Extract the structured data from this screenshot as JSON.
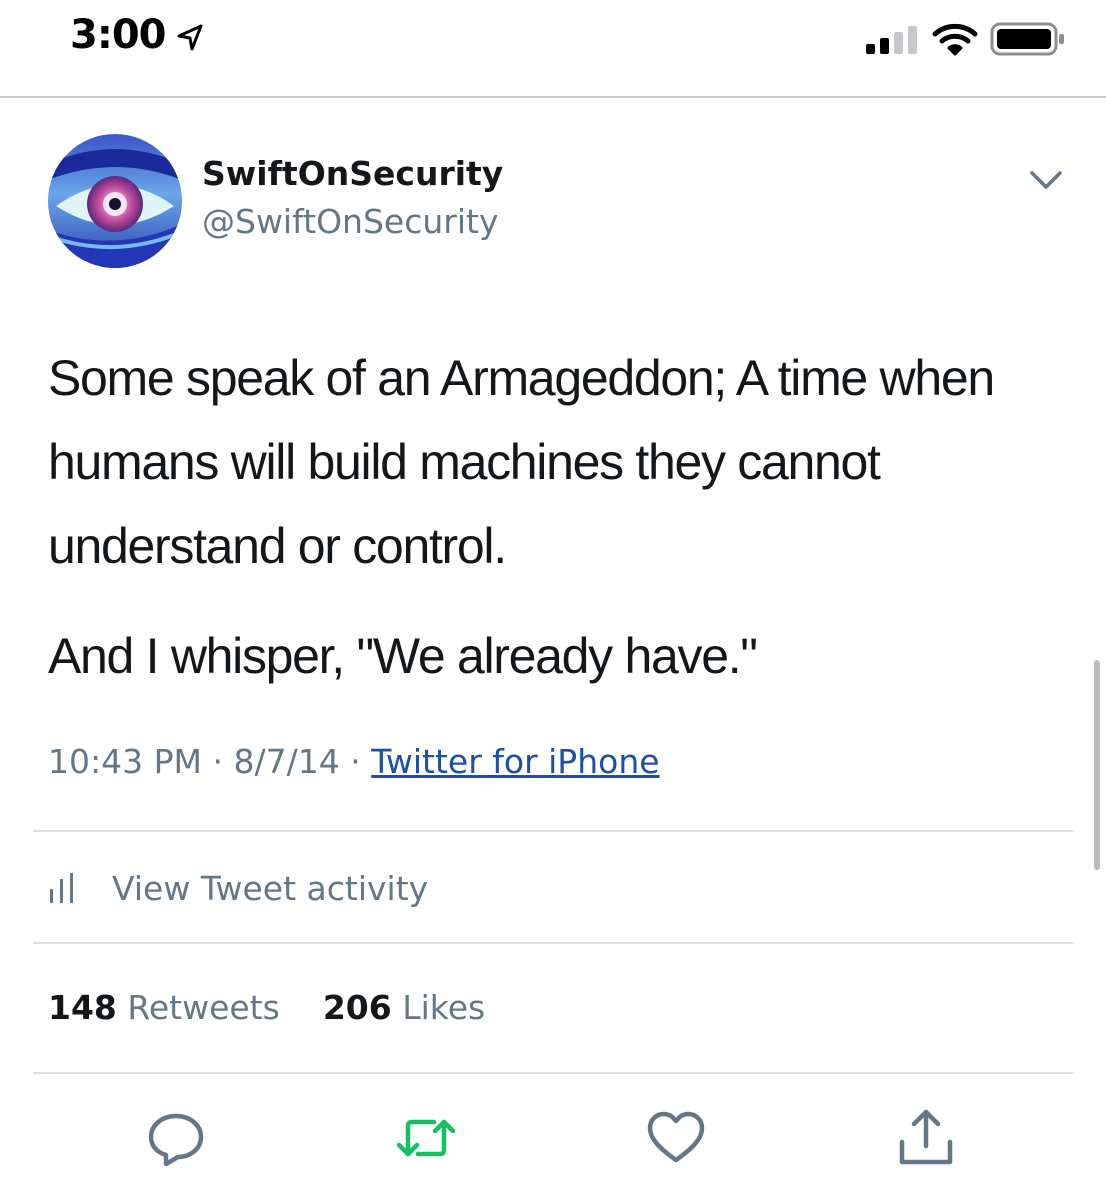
{
  "status_bar": {
    "time": "3:00",
    "icons": [
      "location-arrow-icon",
      "cellular-signal-icon",
      "wifi-icon",
      "battery-icon"
    ]
  },
  "tweet": {
    "display_name": "SwiftOnSecurity",
    "handle": "@SwiftOnSecurity",
    "text_paragraph_1": "Some speak of an Armageddon; A time when humans will build machines they cannot understand or control.",
    "text_paragraph_2": "And I whisper, \"We already have.\"",
    "time": "10:43 PM",
    "separator": "·",
    "date": "8/7/14",
    "source": "Twitter for iPhone"
  },
  "activity": {
    "label": "View Tweet activity",
    "icon": "bar-chart-icon"
  },
  "stats": {
    "retweets_count": "148",
    "retweets_label": "Retweets",
    "likes_count": "206",
    "likes_label": "Likes"
  },
  "actions": [
    "reply-icon",
    "retweet-icon",
    "like-icon",
    "share-icon"
  ],
  "colors": {
    "text": "#14171a",
    "secondary": "#657786",
    "link": "#1b4fa8",
    "retweet_green": "#17bf63",
    "divider": "#dfe3e6"
  }
}
